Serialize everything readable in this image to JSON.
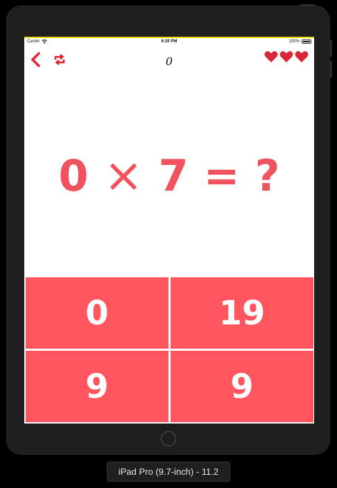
{
  "status_bar": {
    "carrier": "Carrier",
    "time": "6:20 PM",
    "battery": "100%",
    "battery_level": 1.0
  },
  "nav": {
    "back_icon": "chevron-left-icon",
    "repeat_icon": "repeat-icon",
    "score": "0",
    "lives": 3,
    "accent_color": "#e3242f"
  },
  "question": {
    "left": "0",
    "operator": "×",
    "right": "7",
    "equals": "=",
    "unknown": "?"
  },
  "answers": [
    "0",
    "19",
    "9",
    "9"
  ],
  "colors": {
    "answer_bg": "#ff555e",
    "question_text": "#f0535d"
  },
  "simulator": {
    "device_label": "iPad Pro (9.7-inch) - 11.2"
  }
}
